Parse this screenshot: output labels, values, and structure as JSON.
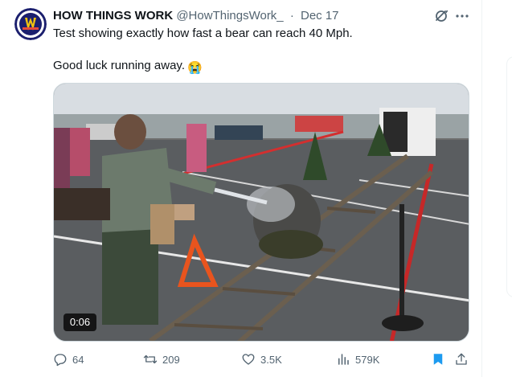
{
  "tweet": {
    "author_name": "HOW THINGS WORK",
    "handle": "@HowThingsWork_",
    "separator": "·",
    "date": "Dec 17",
    "avatar_text": "HOW THINGS WORK",
    "text_line1": "Test showing exactly how fast a bear can reach 40 Mph.",
    "text_line2": "Good luck running away.",
    "emoji": "😭",
    "video_timestamp": "0:06"
  },
  "actions": {
    "replies": "64",
    "retweets": "209",
    "likes": "3.5K",
    "views": "579K"
  },
  "colors": {
    "text": "#0f1419",
    "secondary": "#536471",
    "accent": "#1d9bf0",
    "border": "#cfd9de"
  },
  "icons": [
    "grok-icon",
    "more-icon",
    "reply-icon",
    "retweet-icon",
    "like-icon",
    "views-icon",
    "bookmark-icon",
    "share-icon"
  ]
}
